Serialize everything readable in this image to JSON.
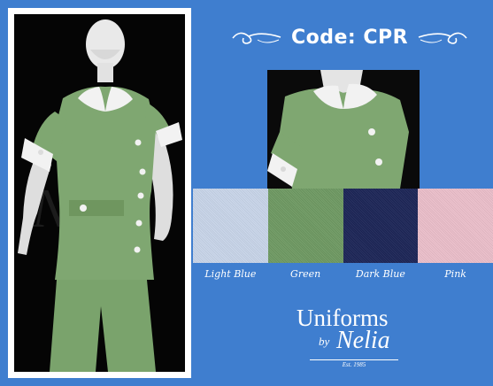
{
  "header": {
    "code_title": "Code: CPR"
  },
  "swatches": [
    {
      "label": "Light Blue",
      "color": "#c9d6ea"
    },
    {
      "label": "Green",
      "color": "#6f9a63"
    },
    {
      "label": "Dark Blue",
      "color": "#1c2557"
    },
    {
      "label": "Pink",
      "color": "#ecbfcb"
    }
  ],
  "photo": {
    "watermark": "Nelia",
    "uniform_color": "#7fa771"
  },
  "logo": {
    "line1": "Uniforms",
    "by": "by",
    "name": "Nelia",
    "est": "Est. 1985"
  },
  "colors": {
    "background": "#3f7ecf",
    "frame": "#ffffff"
  }
}
